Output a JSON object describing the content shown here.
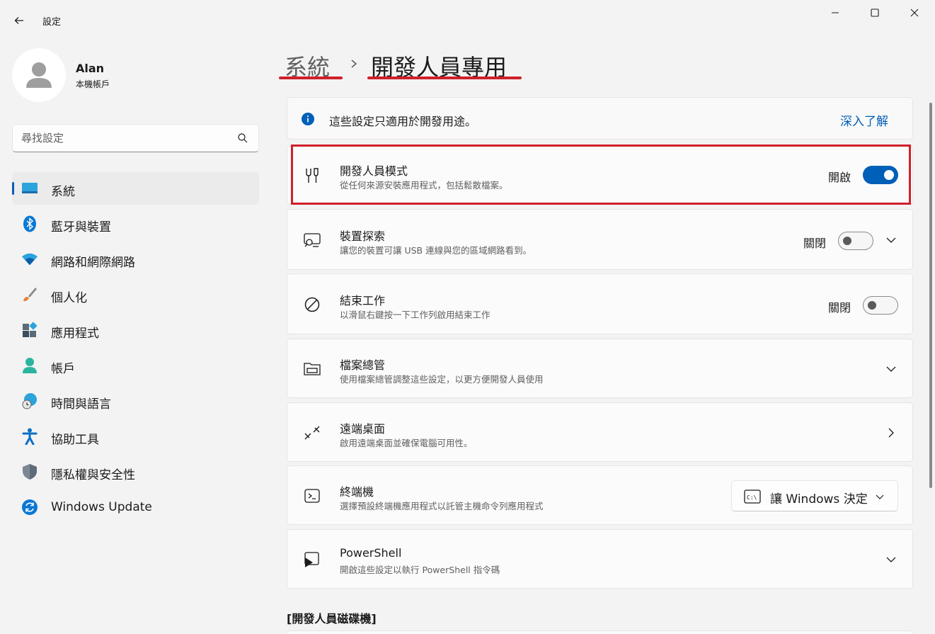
{
  "window": {
    "title": "設定",
    "back_icon": "back-arrow-icon",
    "controls": [
      "minimize",
      "maximize",
      "close"
    ]
  },
  "account": {
    "name": "Alan",
    "type": "本機帳戶"
  },
  "search": {
    "placeholder": "尋找設定"
  },
  "sidebar": {
    "items": [
      {
        "label": "系統",
        "icon": "system-display-icon",
        "active": true
      },
      {
        "label": "藍牙與裝置",
        "icon": "bluetooth-icon",
        "active": false
      },
      {
        "label": "網路和網際網路",
        "icon": "wifi-icon",
        "active": false
      },
      {
        "label": "個人化",
        "icon": "paintbrush-icon",
        "active": false
      },
      {
        "label": "應用程式",
        "icon": "apps-icon",
        "active": false
      },
      {
        "label": "帳戶",
        "icon": "account-icon",
        "active": false
      },
      {
        "label": "時間與語言",
        "icon": "time-language-icon",
        "active": false
      },
      {
        "label": "協助工具",
        "icon": "accessibility-icon",
        "active": false
      },
      {
        "label": "隱私權與安全性",
        "icon": "shield-icon",
        "active": false
      },
      {
        "label": "Windows Update",
        "icon": "windows-update-icon",
        "active": false
      }
    ]
  },
  "breadcrumb": {
    "parent": "系統",
    "current": "開發人員專用"
  },
  "info": {
    "text": "這些設定只適用於開發用途。",
    "link": "深入了解"
  },
  "settings": {
    "developer_mode": {
      "title": "開發人員模式",
      "desc": "從任何來源安裝應用程式，包括鬆散檔案。",
      "state": "開啟",
      "on": true
    },
    "device_discovery": {
      "title": "裝置探索",
      "desc": "讓您的裝置可讓 USB 連線與您的區域網路看到。",
      "state": "關閉",
      "on": false
    },
    "end_task": {
      "title": "結束工作",
      "desc": "以滑鼠右鍵按一下工作列啟用結束工作",
      "state": "關閉",
      "on": false
    },
    "file_explorer": {
      "title": "檔案總管",
      "desc": "使用檔案總管調整這些設定，以更方便開發人員使用"
    },
    "remote_desktop": {
      "title": "遠端桌面",
      "desc": "啟用遠端桌面並確保電腦可用性。"
    },
    "terminal": {
      "title": "終端機",
      "desc": "選擇預設終端機應用程式以託管主機命令列應用程式",
      "dropdown": "讓 Windows 決定"
    },
    "powershell": {
      "title": "PowerShell",
      "desc": "開啟這些設定以執行 PowerShell 指令碼"
    }
  },
  "section": {
    "dev_drive": "[開發人員磁碟機]"
  },
  "colors": {
    "accent": "#005fb8",
    "annotation_red": "#d0202b"
  }
}
